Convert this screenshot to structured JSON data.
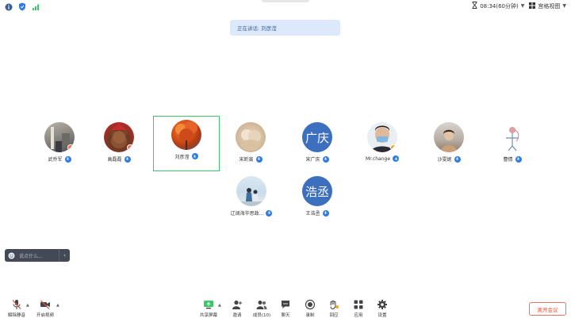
{
  "topbar": {
    "time_display": "08:34(60分钟)",
    "view_label": "宫格视图",
    "icons": [
      "info-icon",
      "shield-icon",
      "signal-icon",
      "hourglass-icon",
      "grid-view-icon"
    ],
    "colors": {
      "info": "#3b5e9a",
      "shield": "#2e7ce0",
      "signal": "#3cc76b"
    }
  },
  "banner": {
    "text": "正在讲话: 刘彦滢"
  },
  "participants": [
    {
      "name": "武乔军",
      "avatar": "photo",
      "mic": "muted",
      "flag": "red"
    },
    {
      "name": "高磊磊",
      "avatar": "photo",
      "mic": "muted",
      "flag": "red"
    },
    {
      "name": "刘彦滢",
      "avatar": "photo",
      "mic": "speaking",
      "active": true
    },
    {
      "name": "宋昕寅",
      "avatar": "photo",
      "mic": "muted"
    },
    {
      "name": "宋广庆",
      "avatar": "text",
      "avatar_text": "广庆",
      "mic": "muted"
    },
    {
      "name": "Mr.change",
      "avatar": "photo",
      "mic": "muted",
      "flag": "orange"
    },
    {
      "name": "沙雯妮",
      "avatar": "photo",
      "mic": "muted"
    },
    {
      "name": "曹倩",
      "avatar": "photo",
      "mic": "muted"
    },
    {
      "name": "辽阔海华思政...",
      "avatar": "photo",
      "mic": "muted"
    },
    {
      "name": "王浩丞",
      "avatar": "text",
      "avatar_text": "浩丞",
      "mic": "muted"
    }
  ],
  "chat": {
    "placeholder": "说点什么..."
  },
  "toolbar": {
    "unmute_label": "解除静音",
    "video_label": "开启视频",
    "share_label": "共享屏幕",
    "invite_label": "邀请",
    "members_label": "成员(10)",
    "chat_label": "聊天",
    "record_label": "录制",
    "rewind_label": "回应",
    "apps_label": "应用",
    "settings_label": "设置",
    "leave_label": "离开会议"
  },
  "colors": {
    "active_border": "#3cc76b",
    "mic_badge": "#2e7ce0",
    "leave": "#e0503a",
    "avatar_text_bg": "#3d6fbf"
  }
}
